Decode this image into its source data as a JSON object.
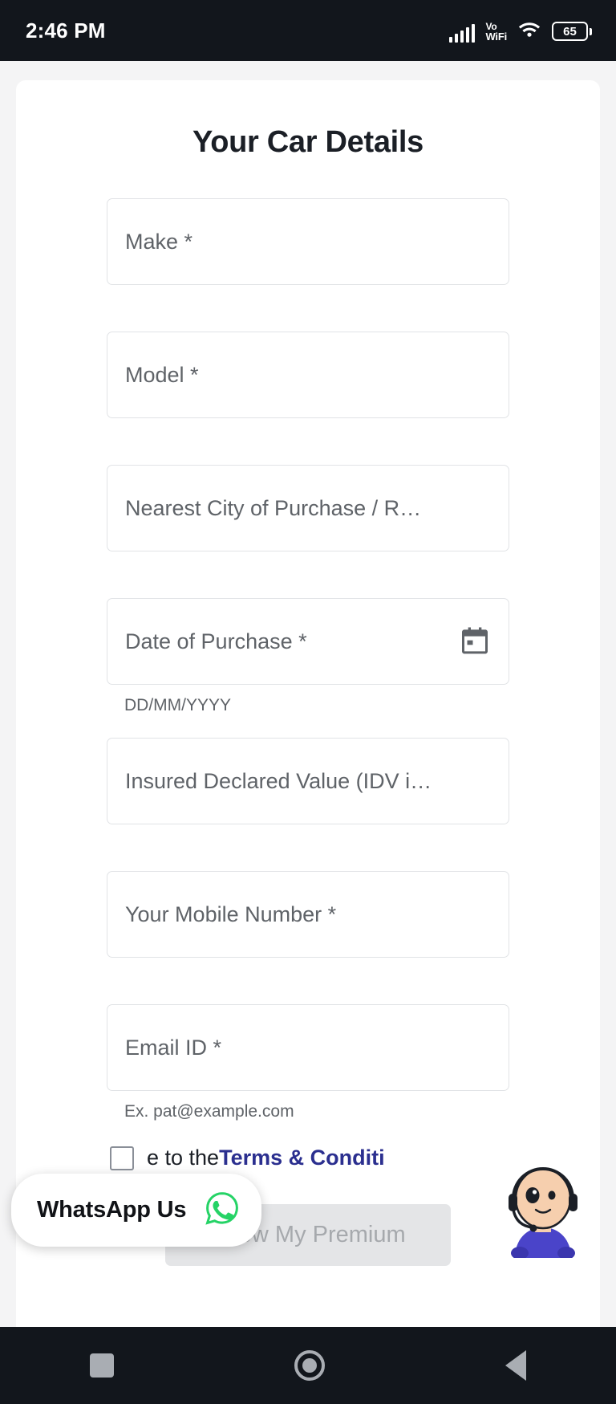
{
  "status_bar": {
    "time": "2:46 PM",
    "network_label_top": "Vo",
    "network_label_bottom": "WiFi",
    "battery_level": "65"
  },
  "page": {
    "title": "Your Car Details"
  },
  "form": {
    "fields": [
      {
        "name": "make",
        "placeholder": "Make *"
      },
      {
        "name": "model",
        "placeholder": "Model *"
      },
      {
        "name": "city",
        "placeholder": "Nearest City of Purchase / R…"
      },
      {
        "name": "date_of_purchase",
        "placeholder": "Date of Purchase *",
        "helper": "DD/MM/YYYY",
        "icon": "calendar-icon"
      },
      {
        "name": "idv",
        "placeholder": "Insured Declared Value (IDV i…"
      },
      {
        "name": "mobile",
        "placeholder": "Your Mobile Number *"
      },
      {
        "name": "email",
        "placeholder": "Email ID *",
        "helper": "Ex. pat@example.com"
      }
    ],
    "terms": {
      "text_before": "e to the ",
      "link_text": "Terms & Conditi"
    },
    "submit_label": "Know My Premium"
  },
  "whatsapp": {
    "label": "WhatsApp Us",
    "icon": "whatsapp-icon",
    "color": "#25D366"
  },
  "nav_bar": {
    "recents": "recents-icon",
    "home": "home-icon",
    "back": "back-icon"
  },
  "colors": {
    "status_bar_bg": "#12161c",
    "page_bg": "#f4f4f5",
    "card_bg": "#ffffff",
    "border": "#e1e3e6",
    "placeholder": "#5f6368",
    "title": "#1b1f26",
    "link": "#2b2f8f",
    "button_bg": "#e4e5e7",
    "button_text": "#a6a9ad"
  }
}
